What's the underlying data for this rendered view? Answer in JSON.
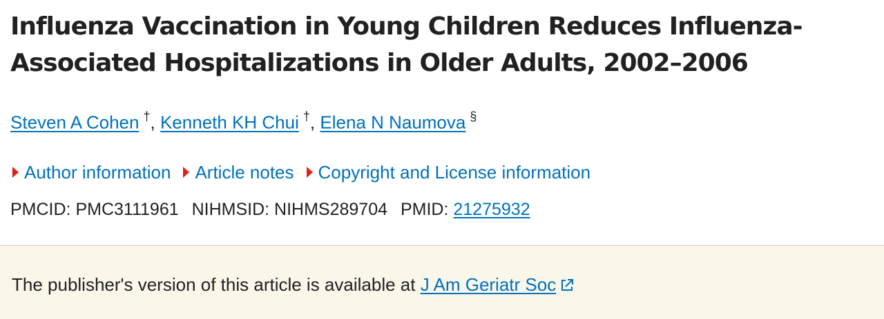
{
  "article": {
    "title": "Influenza Vaccination in Young Children Reduces Influenza-Associated Hospitalizations in Older Adults, 2002–2006"
  },
  "authors": [
    {
      "name": "Steven A Cohen",
      "mark": "†",
      "separator": ","
    },
    {
      "name": "Kenneth KH Chui",
      "mark": "†",
      "separator": ","
    },
    {
      "name": "Elena N Naumova",
      "mark": "§",
      "separator": ""
    }
  ],
  "toggles": {
    "author_info": "Author information",
    "article_notes": "Article notes",
    "copyright": "Copyright and License information"
  },
  "ids": {
    "pmcid_label": "PMCID:",
    "pmcid": "PMC3111961",
    "nihmsid_label": "NIHMSID:",
    "nihmsid": "NIHMS289704",
    "pmid_label": "PMID:",
    "pmid": "21275932"
  },
  "banner": {
    "text": "The publisher's version of this article is available at",
    "link": "J Am Geriatr Soc"
  },
  "colors": {
    "link": "#0071bc",
    "caret": "#e0201b",
    "banner_bg": "#fbf6ea"
  }
}
